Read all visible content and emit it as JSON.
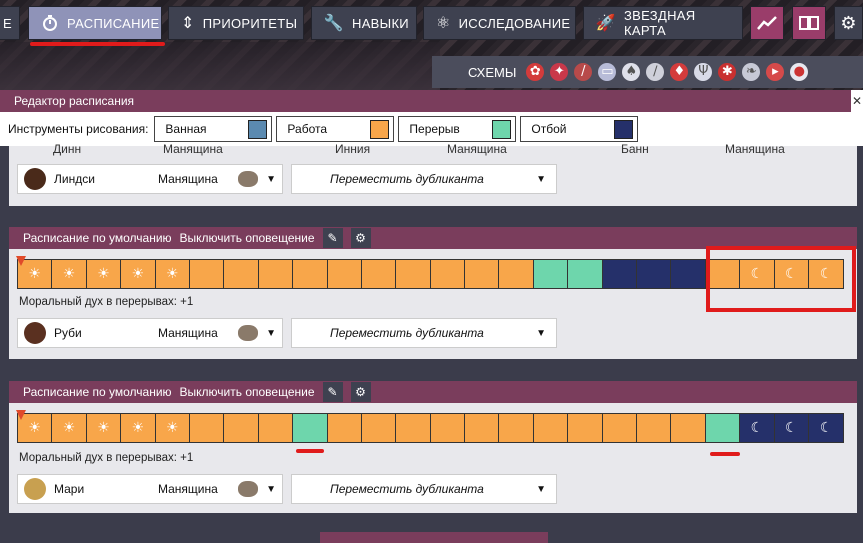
{
  "nav": {
    "partial_label": "Е",
    "items": [
      {
        "label": "РАСПИСАНИЕ",
        "icon": "stopwatch-icon",
        "active": true
      },
      {
        "label": "ПРИОРИТЕТЫ",
        "icon": "priority-icon",
        "active": false
      },
      {
        "label": "НАВЫКИ",
        "icon": "wrench-icon",
        "active": false
      },
      {
        "label": "ИССЛЕДОВАНИЕ",
        "icon": "atom-icon",
        "active": false
      },
      {
        "label": "ЗВЕЗДНАЯ КАРТА",
        "icon": "rocket-icon",
        "active": false
      }
    ],
    "icon_buttons": [
      "chart-icon",
      "book-icon",
      "gear-icon"
    ]
  },
  "schemes": {
    "label": "СХЕМЫ",
    "icons": [
      "flower-icon",
      "bug-icon",
      "brush-icon",
      "canvas-icon",
      "mushroom-icon",
      "syringe-icon",
      "pepper-icon",
      "plant-icon",
      "beetle-icon",
      "leaf-icon",
      "gun-icon",
      "pill-icon"
    ]
  },
  "editor": {
    "title": "Редактор расписания",
    "tools_label": "Инструменты рисования:",
    "tools": [
      {
        "label": "Ванная",
        "color": "#5b8ab0"
      },
      {
        "label": "Работа",
        "color": "#f8a64a"
      },
      {
        "label": "Перерыв",
        "color": "#6ed6ac"
      },
      {
        "label": "Отбой",
        "color": "#25306a"
      }
    ]
  },
  "partial_card": {
    "top_row": [
      "Динн",
      "Манящина",
      "Инния",
      "Манящина",
      "Банн",
      "Манящина"
    ],
    "dupe": {
      "name": "Линдси",
      "stress": "Манящина"
    },
    "move_label": "Переместить дубликанта"
  },
  "cards": [
    {
      "title": "Расписание по умолчанию",
      "alert": "Выключить оповещение",
      "blocks": [
        "sun",
        "sun",
        "sun",
        "sun",
        "sun",
        "work",
        "work",
        "work",
        "work",
        "work",
        "work",
        "work",
        "work",
        "work",
        "work",
        "break",
        "break",
        "night",
        "night",
        "night",
        "work",
        "moon-work",
        "moon-work",
        "moon-work"
      ],
      "morale": "Моральный дух в перерывах: +1",
      "dupe": {
        "name": "Руби",
        "stress": "Манящина"
      },
      "move_label": "Переместить дубликанта"
    },
    {
      "title": "Расписание по умолчанию",
      "alert": "Выключить оповещение",
      "blocks": [
        "sun",
        "sun",
        "sun",
        "sun",
        "sun",
        "work",
        "work",
        "work",
        "break",
        "work",
        "work",
        "work",
        "work",
        "work",
        "work",
        "work",
        "work",
        "work",
        "work",
        "work",
        "break",
        "moon-night",
        "moon-night",
        "moon-night"
      ],
      "morale": "Моральный дух в перерывах: +1",
      "dupe": {
        "name": "Мари",
        "stress": "Манящина"
      },
      "move_label": "Переместить дубликанта"
    }
  ],
  "colors": {
    "work": "#f8a64a",
    "break": "#6ed6ac",
    "night": "#25306a",
    "bath": "#5b8ab0",
    "header": "#7a3d5c",
    "highlight": "#e01b1b"
  }
}
